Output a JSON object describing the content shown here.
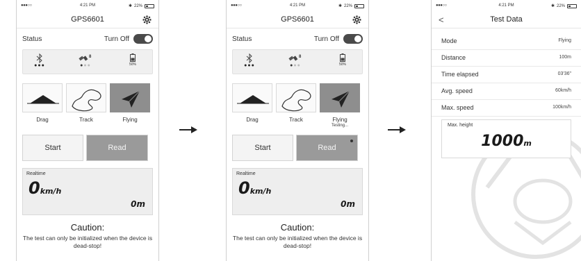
{
  "status_bar": {
    "signal": "●●●○○",
    "wifi_icon": "wifi-icon",
    "time": "4:21 PM",
    "bt": "✱",
    "battery": "22%"
  },
  "screen1": {
    "title": "GPS6601",
    "status_label": "Status",
    "turn_off_label": "Turn Off",
    "battery_percent": "50%",
    "gps_count": "8",
    "modes": [
      {
        "label": "Drag",
        "sub": ""
      },
      {
        "label": "Track",
        "sub": ""
      },
      {
        "label": "Flying",
        "sub": ""
      }
    ],
    "start_label": "Start",
    "read_label": "Read",
    "realtime_label": "Realtime",
    "speed_value": "0",
    "speed_unit": "km/h",
    "distance_value": "0",
    "distance_unit": "m",
    "caution_title": "Caution:",
    "caution_text": "The test can only be initialized when the device is dead-stop!"
  },
  "screen2": {
    "title": "GPS6601",
    "status_label": "Status",
    "turn_off_label": "Turn Off",
    "battery_percent": "50%",
    "gps_count": "8",
    "modes": [
      {
        "label": "Drag",
        "sub": ""
      },
      {
        "label": "Track",
        "sub": ""
      },
      {
        "label": "Flying",
        "sub": "Testing..."
      }
    ],
    "start_label": "Start",
    "read_label": "Read",
    "realtime_label": "Realtime",
    "speed_value": "0",
    "speed_unit": "km/h",
    "distance_value": "0",
    "distance_unit": "m",
    "caution_title": "Caution:",
    "caution_text": "The test can only be initialized when the device is dead-stop!"
  },
  "screen3": {
    "back": "<",
    "title": "Test Data",
    "rows": [
      {
        "label": "Mode",
        "value": "Flying"
      },
      {
        "label": "Distance",
        "value": "100m"
      },
      {
        "label": "Time elapsed",
        "value": "03'36\""
      },
      {
        "label": "Avg. speed",
        "value": "60km/h"
      },
      {
        "label": "Max. speed",
        "value": "100km/h"
      }
    ],
    "max_height_label": "Max. height",
    "max_height_value": "1000",
    "max_height_unit": "m"
  },
  "colors": {
    "selected_tile": "#8e8e8e",
    "toggle": "#4a4a4a",
    "panel": "#eeeeee"
  }
}
